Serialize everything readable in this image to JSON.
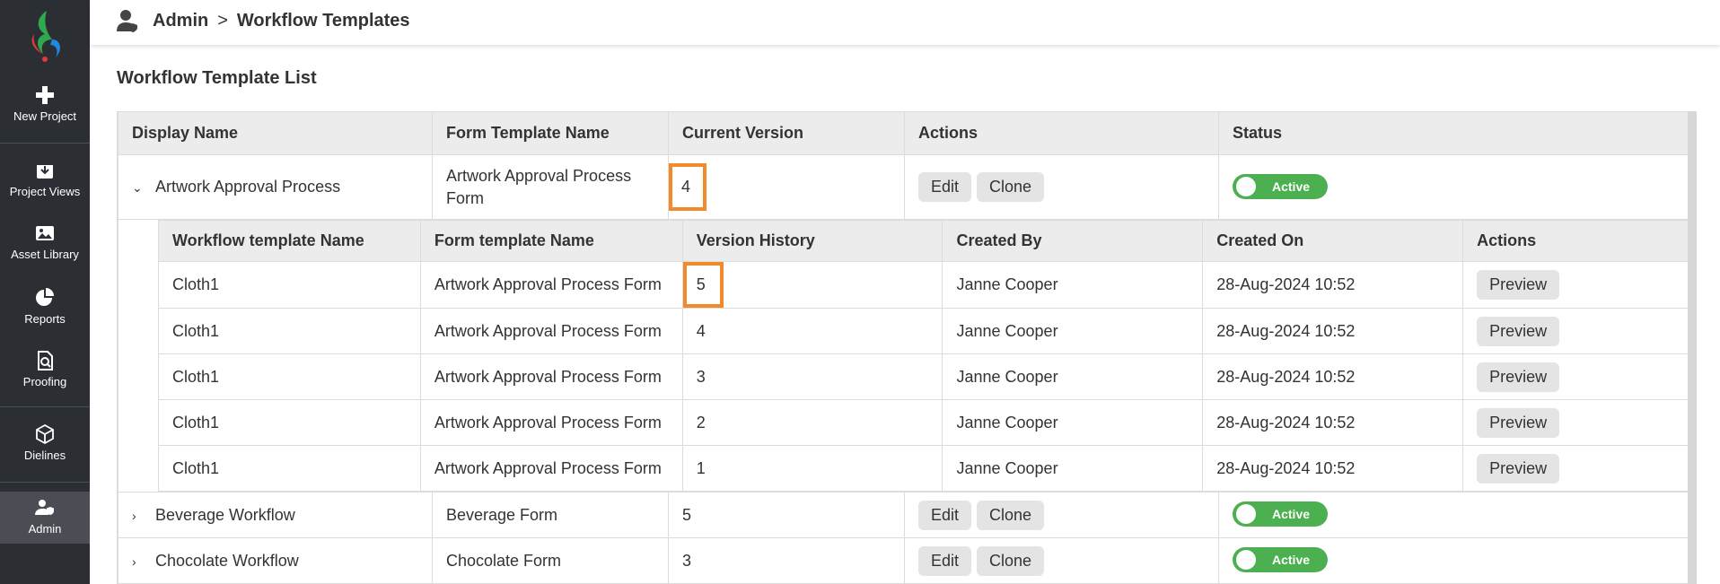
{
  "sidebar": {
    "items": [
      {
        "label": "New Project",
        "icon": "plus-icon"
      },
      {
        "label": "Project Views",
        "icon": "download-box-icon"
      },
      {
        "label": "Asset Library",
        "icon": "image-icon"
      },
      {
        "label": "Reports",
        "icon": "pie-chart-icon"
      },
      {
        "label": "Proofing",
        "icon": "document-search-icon"
      },
      {
        "label": "Dielines",
        "icon": "box-icon"
      },
      {
        "label": "Admin",
        "icon": "user-shield-icon"
      }
    ],
    "active": "Admin"
  },
  "header": {
    "crumb_root": "Admin",
    "crumb_sep": ">",
    "crumb_current": "Workflow Templates"
  },
  "page_title": "Workflow Template List",
  "columns": {
    "display_name": "Display Name",
    "form_template_name": "Form Template Name",
    "current_version": "Current Version",
    "actions": "Actions",
    "status": "Status"
  },
  "buttons": {
    "edit": "Edit",
    "clone": "Clone",
    "preview": "Preview"
  },
  "colors": {
    "accent_active": "#4caf50",
    "highlight": "#f08a2a",
    "sidebar": "#2b2e33"
  },
  "rows": [
    {
      "display_name": "Artwork Approval Process",
      "form_template": "Artwork Approval Process Form",
      "version": "4",
      "status": "Active",
      "expanded": true
    },
    {
      "display_name": "Beverage Workflow",
      "form_template": "Beverage Form",
      "version": "5",
      "status": "Active",
      "expanded": false
    },
    {
      "display_name": "Chocolate Workflow",
      "form_template": "Chocolate Form",
      "version": "3",
      "status": "Active",
      "expanded": false
    }
  ],
  "history": {
    "columns": {
      "workflow_template_name": "Workflow template Name",
      "form_template_name": "Form template Name",
      "version_history": "Version History",
      "created_by": "Created By",
      "created_on": "Created On",
      "actions": "Actions"
    },
    "rows": [
      {
        "workflow": "Cloth1",
        "form": "Artwork Approval Process Form",
        "version": "5",
        "created_by": "Janne Cooper",
        "created_on": "28-Aug-2024 10:52"
      },
      {
        "workflow": "Cloth1",
        "form": "Artwork Approval Process Form",
        "version": "4",
        "created_by": "Janne Cooper",
        "created_on": "28-Aug-2024 10:52"
      },
      {
        "workflow": "Cloth1",
        "form": "Artwork Approval Process Form",
        "version": "3",
        "created_by": "Janne Cooper",
        "created_on": "28-Aug-2024 10:52"
      },
      {
        "workflow": "Cloth1",
        "form": "Artwork Approval Process Form",
        "version": "2",
        "created_by": "Janne Cooper",
        "created_on": "28-Aug-2024 10:52"
      },
      {
        "workflow": "Cloth1",
        "form": "Artwork Approval Process Form",
        "version": "1",
        "created_by": "Janne Cooper",
        "created_on": "28-Aug-2024 10:52"
      }
    ]
  }
}
